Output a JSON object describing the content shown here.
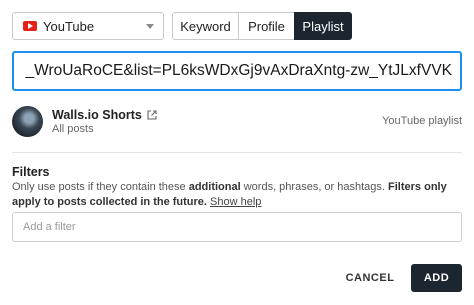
{
  "source_select": {
    "value": "YouTube",
    "icon": "youtube-icon"
  },
  "tabs": [
    {
      "label": "Keyword",
      "active": false
    },
    {
      "label": "Profile",
      "active": false
    },
    {
      "label": "Playlist",
      "active": true
    }
  ],
  "url_input": {
    "value": "_WroUaRoCE&list=PL6ksWDxGj9vAxDraXntg-zw_YtJLxfVVK"
  },
  "channel": {
    "name": "Walls.io Shorts",
    "subtitle": "All posts",
    "source_type": "YouTube playlist"
  },
  "filters": {
    "title": "Filters",
    "desc_part1": "Only use posts if they contain these ",
    "desc_bold1": "additional",
    "desc_part2": " words, phrases, or hashtags. ",
    "desc_bold2": "Filters only apply to posts collected in the future.",
    "show_help": "Show help",
    "placeholder": "Add a filter"
  },
  "actions": {
    "cancel": "CANCEL",
    "add": "ADD"
  },
  "colors": {
    "accent": "#1c8ff0",
    "dark": "#1c2631",
    "youtube": "#e62117"
  }
}
